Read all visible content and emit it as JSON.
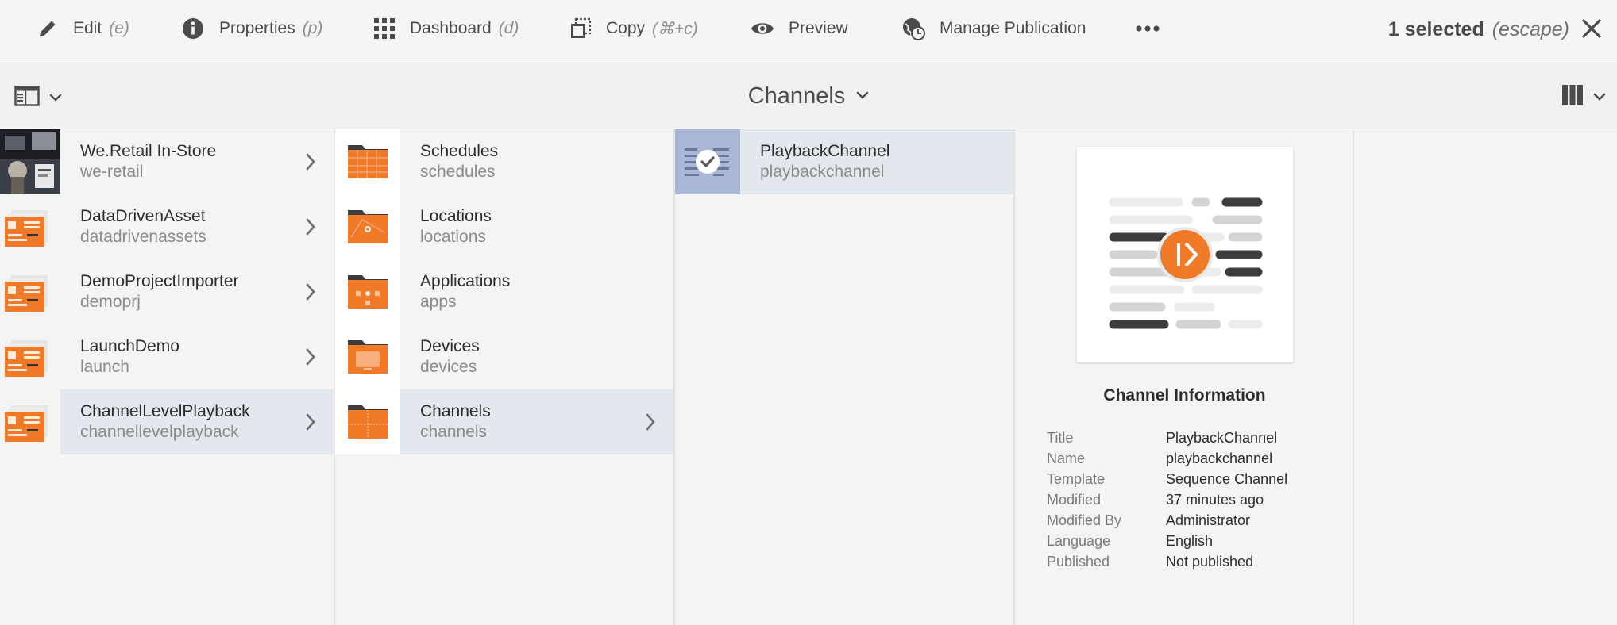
{
  "actions": [
    {
      "label": "Edit",
      "shortcut": "(e)",
      "icon": "pencil-icon"
    },
    {
      "label": "Properties",
      "shortcut": "(p)",
      "icon": "info-icon"
    },
    {
      "label": "Dashboard",
      "shortcut": "(d)",
      "icon": "grid-icon"
    },
    {
      "label": "Copy",
      "shortcut": "(⌘+c)",
      "icon": "copy-icon"
    },
    {
      "label": "Preview",
      "shortcut": "",
      "icon": "eye-icon"
    },
    {
      "label": "Manage Publication",
      "shortcut": "",
      "icon": "globe-clock-icon"
    }
  ],
  "selection": {
    "count_label": "1 selected",
    "escape_label": "(escape)"
  },
  "title": {
    "label": "Channels"
  },
  "columns": {
    "projects": [
      {
        "name": "We.Retail In-Store",
        "sub": "we-retail",
        "thumb": "photo-thumbnail"
      },
      {
        "name": "DataDrivenAsset",
        "sub": "datadrivenassets",
        "thumb": "project-icon"
      },
      {
        "name": "DemoProjectImporter",
        "sub": "demoprj",
        "thumb": "project-icon"
      },
      {
        "name": "LaunchDemo",
        "sub": "launch",
        "thumb": "project-icon"
      },
      {
        "name": "ChannelLevelPlayback",
        "sub": "channellevelplayback",
        "thumb": "project-icon",
        "active": true
      }
    ],
    "folders": [
      {
        "name": "Schedules",
        "sub": "schedules",
        "icon": "schedules-folder-icon"
      },
      {
        "name": "Locations",
        "sub": "locations",
        "icon": "locations-folder-icon"
      },
      {
        "name": "Applications",
        "sub": "apps",
        "icon": "applications-folder-icon"
      },
      {
        "name": "Devices",
        "sub": "devices",
        "icon": "devices-folder-icon"
      },
      {
        "name": "Channels",
        "sub": "channels",
        "icon": "channels-folder-icon",
        "active": true
      }
    ],
    "channels": [
      {
        "name": "PlaybackChannel",
        "sub": "playbackchannel",
        "selected": true
      }
    ]
  },
  "preview": {
    "heading": "Channel Information",
    "fields": [
      {
        "key": "Title",
        "value": "PlaybackChannel"
      },
      {
        "key": "Name",
        "value": "playbackchannel"
      },
      {
        "key": "Template",
        "value": "Sequence Channel"
      },
      {
        "key": "Modified",
        "value": "37 minutes ago"
      },
      {
        "key": "Modified By",
        "value": "Administrator"
      },
      {
        "key": "Language",
        "value": "English"
      },
      {
        "key": "Published",
        "value": "Not published"
      }
    ]
  },
  "colors": {
    "accent": "#f07a27",
    "selection": "#aab7d9",
    "active_row": "#e3e7ee"
  }
}
